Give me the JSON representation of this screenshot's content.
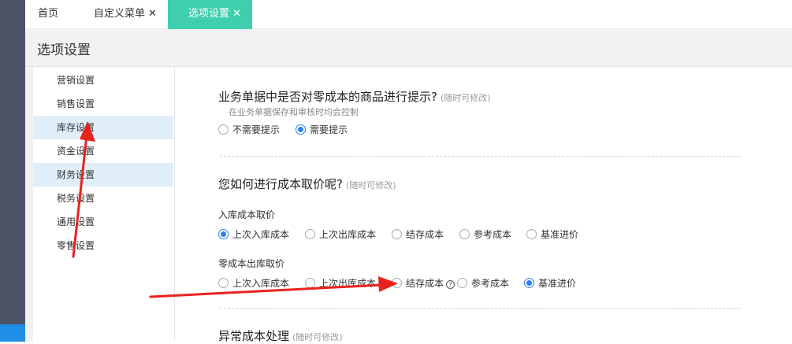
{
  "tabs": [
    {
      "label": "首页",
      "closable": false,
      "active": false
    },
    {
      "label": "自定义菜单",
      "closable": true,
      "active": false
    },
    {
      "label": "选项设置",
      "closable": true,
      "active": true
    }
  ],
  "close_glyph": "✕",
  "page_title": "选项设置",
  "sidebar": {
    "items": [
      {
        "label": "营销设置",
        "selected": false
      },
      {
        "label": "销售设置",
        "selected": false
      },
      {
        "label": "库存设置",
        "selected": true
      },
      {
        "label": "资金设置",
        "selected": false
      },
      {
        "label": "财务设置",
        "selected": true
      },
      {
        "label": "税务设置",
        "selected": false
      },
      {
        "label": "通用设置",
        "selected": false
      },
      {
        "label": "零售设置",
        "selected": false
      }
    ]
  },
  "sections": {
    "zero_cost_prompt": {
      "title": "业务单据中是否对零成本的商品进行提示?",
      "hint": "(随时可修改)",
      "note": "在业务单据保存和审核时均会控制",
      "options": [
        {
          "label": "不需要提示",
          "checked": false
        },
        {
          "label": "需要提示",
          "checked": true
        }
      ]
    },
    "cost_pricing": {
      "title": "您如何进行成本取价呢?",
      "hint": "(随时可修改)",
      "inbound": {
        "label": "入库成本取价",
        "options": [
          {
            "label": "上次入库成本",
            "checked": true
          },
          {
            "label": "上次出库成本",
            "checked": false
          },
          {
            "label": "结存成本",
            "checked": false
          },
          {
            "label": "参考成本",
            "checked": false
          },
          {
            "label": "基准进价",
            "checked": false
          }
        ]
      },
      "zero_outbound": {
        "label": "零成本出库取价",
        "options": [
          {
            "label": "上次入库成本",
            "checked": false
          },
          {
            "label": "上次出库成本",
            "checked": false
          },
          {
            "label": "结存成本",
            "checked": false,
            "help": "?"
          },
          {
            "label": "参考成本",
            "checked": false
          },
          {
            "label": "基准进价",
            "checked": true
          }
        ]
      }
    },
    "abnormal_cost": {
      "title": "异常成本处理",
      "hint": "(随时可修改)"
    }
  },
  "colors": {
    "tab_active": "#3fcfae",
    "radio_checked": "#2d7ff0",
    "sidebar_selected": "#e0eefa",
    "annotation_arrow": "#e8231d"
  }
}
